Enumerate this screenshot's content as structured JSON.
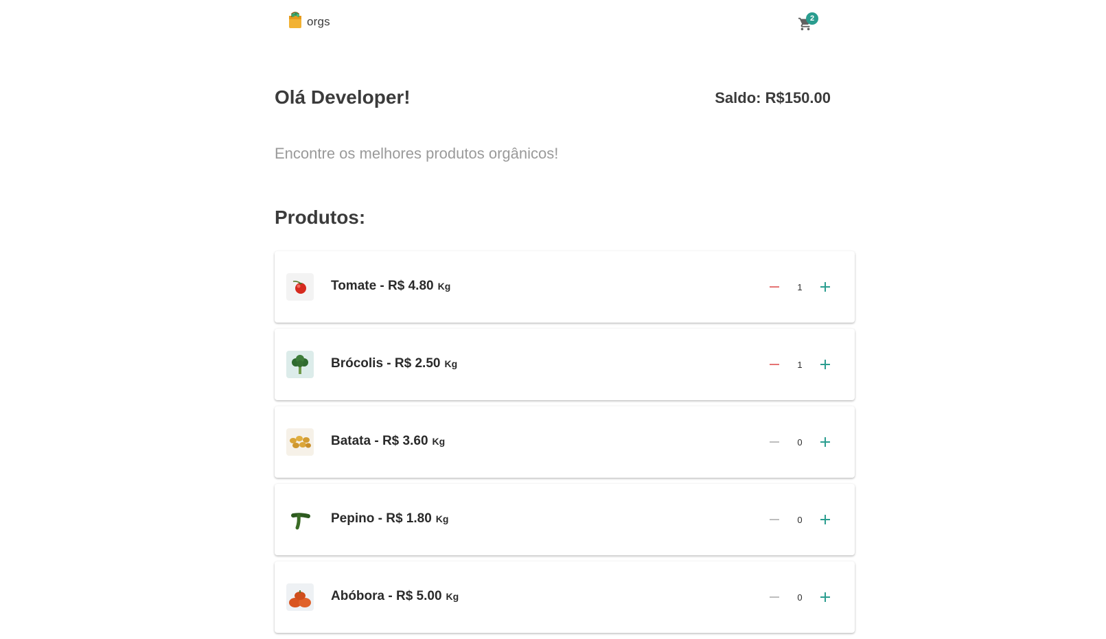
{
  "header": {
    "logo_text": "orgs",
    "cart_count": "2",
    "icons": {
      "logo": "shopping-bag-icon",
      "cart": "cart-icon"
    }
  },
  "greeting": "Olá Developer!",
  "saldo": "Saldo: R$150.00",
  "subtitle": "Encontre os melhores produtos orgânicos!",
  "section_title": "Produtos:",
  "colors": {
    "accent": "#2a9d8f",
    "decrement_active": "#e57373",
    "decrement_disabled": "#bdbdbd",
    "subtitle": "#9a9a9a"
  },
  "products": [
    {
      "name": "Tomate - R$ 4.80",
      "unit": "Kg",
      "quantity": "1",
      "icon": "tomato-icon"
    },
    {
      "name": "Brócolis - R$ 2.50",
      "unit": "Kg",
      "quantity": "1",
      "icon": "broccoli-icon"
    },
    {
      "name": "Batata - R$ 3.60",
      "unit": "Kg",
      "quantity": "0",
      "icon": "potato-icon"
    },
    {
      "name": "Pepino - R$ 1.80",
      "unit": "Kg",
      "quantity": "0",
      "icon": "cucumber-icon"
    },
    {
      "name": "Abóbora - R$ 5.00",
      "unit": "Kg",
      "quantity": "0",
      "icon": "pumpkin-icon"
    }
  ]
}
